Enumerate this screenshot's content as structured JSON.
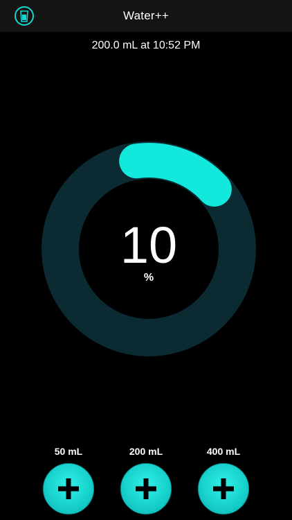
{
  "header": {
    "title": "Water++",
    "icon": "glass-icon"
  },
  "last_entry": "200.0 mL at 10:52 PM",
  "progress": {
    "value": "10",
    "unit": "%",
    "fraction": 0.1
  },
  "quick_add": [
    {
      "label": "50 mL",
      "icon": "plus-icon"
    },
    {
      "label": "200 mL",
      "icon": "plus-icon"
    },
    {
      "label": "400 mL",
      "icon": "plus-icon"
    }
  ],
  "colors": {
    "accent": "#12e8dc",
    "ring_track": "#0b2a31",
    "background": "#000000",
    "topbar": "#141414"
  }
}
